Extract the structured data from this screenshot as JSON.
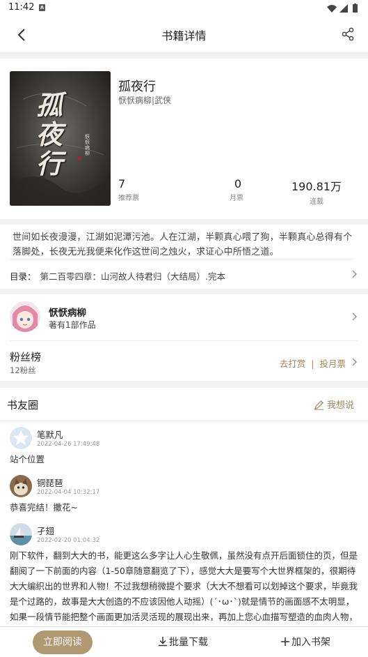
{
  "status": {
    "time": "11:42",
    "app_badge": "A"
  },
  "nav": {
    "title": "书籍详情"
  },
  "book": {
    "cover_text": "孤夜行",
    "cover_author": "恹恹病柳",
    "title": "孤夜行",
    "meta": "恹恹病柳|武侠",
    "stats": [
      {
        "num": "7",
        "label": "推荐票"
      },
      {
        "num": "0",
        "label": "月票"
      },
      {
        "num": "190.81万",
        "label": "连载"
      }
    ]
  },
  "intro": {
    "description": "世间如长夜漫漫，江湖如泥潭污池。人在江湖，半颗真心喂了狗，半颗真心总得有个落脚处，长夜无光我便来化作这世间之烛火，求证心中所悟之道。",
    "toc_label": "目录：",
    "toc_value": "第二百零四章：山河故人待君归（大结局）.完本"
  },
  "author": {
    "name": "恹恹病柳",
    "works": "著有1部作品",
    "fan_title": "粉丝榜",
    "fan_count": "12粉丝",
    "tip": "去打赏",
    "separator": "|",
    "vote": "投月票"
  },
  "circle": {
    "title": "书友圈",
    "want": "我想说",
    "posts": [
      {
        "user": "笔默凡",
        "date": "2022-04-26 17:49:48",
        "content": "站个位置"
      },
      {
        "user": "铜琵琶",
        "date": "2022-04-04 10:32:17",
        "content": "恭喜完结！撒花~"
      },
      {
        "user": "孑翅",
        "date": "2022-02-20 01:04:32",
        "content": "刚下软件，翻到大大的书，能更这么多字让人心生敬佩，虽然没有点开后面锁住的页，但是翻阅了一下前面的内容（1-50章随意翻览了下），感觉大大是要写个大世界框架的，很期待大大编织出的世界和人物！不过我想稍微提个要求（大大不想看可以划掉这个要求，毕竟我是个过路的，故事是大大创造的不应该因他人动摇）(´･ω･`)就是情节的画面感不太明显，如果一段情节能把整个画面更加活灵活现的展现出来，再加上您心血描写塑造的血肉人物，那"
      }
    ]
  },
  "bottom": {
    "read": "立即阅读",
    "download": "批量下载",
    "add": "加入书架"
  },
  "colors": {
    "accent": "#b09872",
    "accent_text": "#a0865c"
  }
}
